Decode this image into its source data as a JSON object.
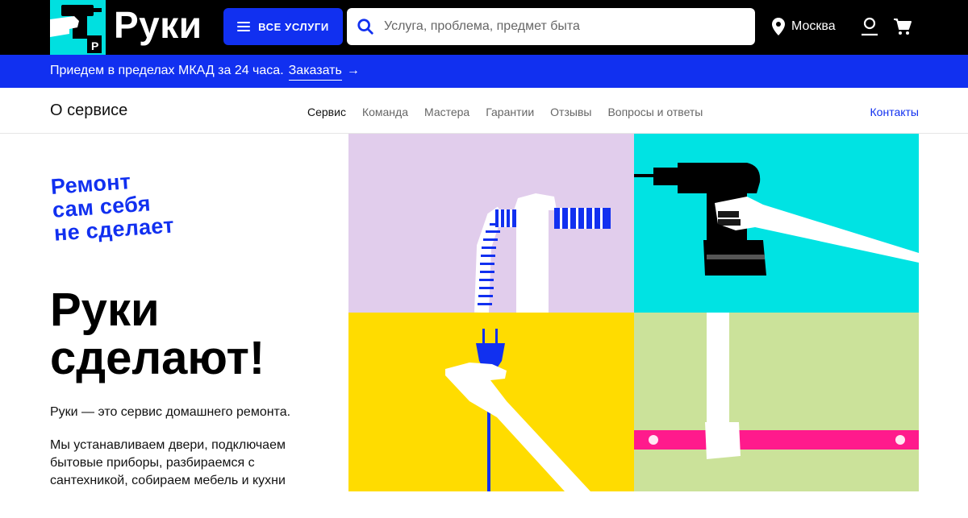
{
  "header": {
    "logo_text": "Руки",
    "logo_mark_letter": "Р",
    "services_button": "ВСЕ УСЛУГИ",
    "search_placeholder": "Услуга, проблема, предмет быта",
    "city": "Москва",
    "icons": [
      "logo-mark-icon",
      "burger-icon",
      "search-icon",
      "location-pin-icon",
      "user-icon",
      "cart-icon"
    ]
  },
  "promo": {
    "text": "Приедем в пределах МКАД за 24 часа.",
    "link": "Заказать",
    "arrow": "→"
  },
  "subnav": {
    "title": "О сервисе",
    "links": [
      "Сервис",
      "Команда",
      "Мастера",
      "Гарантии",
      "Отзывы",
      "Вопросы и ответы"
    ],
    "active": "Сервис",
    "contacts": "Контакты"
  },
  "hero": {
    "tagline": [
      "Ремонт",
      "сам себя",
      "не сделает"
    ],
    "title": [
      "Руки",
      "сделают!"
    ],
    "paragraph1": "Руки — это сервис домашнего ремонта.",
    "paragraph2": "Мы устанавливаем двери, подключаем бытовые приборы, разбираемся с сантехникой, собираем мебель и кухни"
  },
  "colors": {
    "black": "#000000",
    "brand_blue": "#1130f0",
    "cyan": "#00e3e3",
    "lavender": "#e1cdec",
    "yellow": "#ffdc00",
    "light_green": "#cbe29a",
    "pink": "#ff1a8c"
  }
}
